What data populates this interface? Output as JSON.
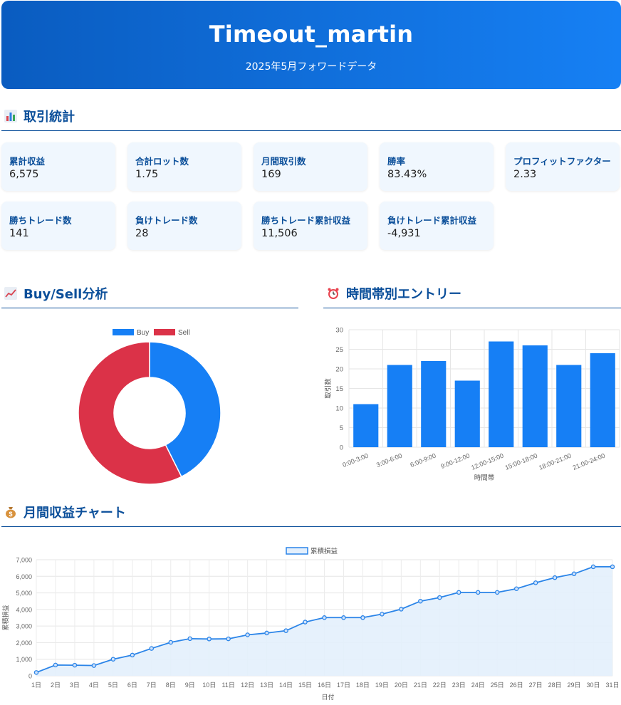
{
  "header": {
    "title": "Timeout_martin",
    "subtitle": "2025年5月フォワードデータ"
  },
  "sections": {
    "stats": {
      "icon": "bar-chart-icon",
      "title": "取引統計"
    },
    "buysell": {
      "icon": "trend-chart-icon",
      "title": "Buy/Sell分析"
    },
    "time": {
      "icon": "alarm-clock-icon",
      "title": "時間帯別エントリー"
    },
    "monthly": {
      "icon": "money-bag-icon",
      "title": "月間収益チャート"
    }
  },
  "stats": [
    {
      "label": "累計収益",
      "value": "6,575"
    },
    {
      "label": "合計ロット数",
      "value": "1.75"
    },
    {
      "label": "月間取引数",
      "value": "169"
    },
    {
      "label": "勝率",
      "value": "83.43%"
    },
    {
      "label": "プロフィットファクター",
      "value": "2.33"
    },
    {
      "label": "勝ちトレード数",
      "value": "141"
    },
    {
      "label": "負けトレード数",
      "value": "28"
    },
    {
      "label": "勝ちトレード累計収益",
      "value": "11,506"
    },
    {
      "label": "負けトレード累計収益",
      "value": "-4,931"
    }
  ],
  "chart_data": [
    {
      "type": "pie",
      "subtype": "doughnut",
      "categories": [
        "Buy",
        "Sell"
      ],
      "values": [
        72,
        97
      ],
      "colors": [
        "#167ff5",
        "#db3248"
      ],
      "legend": "top"
    },
    {
      "type": "bar",
      "categories": [
        "0:00-3:00",
        "3:00-6:00",
        "6:00-9:00",
        "9:00-12:00",
        "12:00-15:00",
        "15:00-18:00",
        "18:00-21:00",
        "21:00-24:00"
      ],
      "values": [
        11,
        21,
        22,
        17,
        27,
        26,
        21,
        24
      ],
      "xlabel": "時間帯",
      "ylabel": "取引数",
      "ylim": [
        0,
        30
      ],
      "yticks": [
        0,
        5,
        10,
        15,
        20,
        25,
        30
      ],
      "color": "#167ff5",
      "grid": true
    },
    {
      "type": "area",
      "x": [
        "1日",
        "2日",
        "3日",
        "4日",
        "5日",
        "6日",
        "7日",
        "8日",
        "9日",
        "10日",
        "11日",
        "12日",
        "13日",
        "14日",
        "15日",
        "16日",
        "17日",
        "18日",
        "19日",
        "20日",
        "21日",
        "22日",
        "23日",
        "24日",
        "25日",
        "26日",
        "27日",
        "28日",
        "29日",
        "30日",
        "31日"
      ],
      "series": [
        {
          "name": "累積損益",
          "values": [
            200,
            650,
            640,
            620,
            1000,
            1250,
            1650,
            2020,
            2240,
            2220,
            2230,
            2470,
            2580,
            2720,
            3240,
            3510,
            3510,
            3510,
            3720,
            4020,
            4500,
            4720,
            5030,
            5030,
            5030,
            5250,
            5610,
            5920,
            6150,
            6575,
            6575
          ]
        }
      ],
      "xlabel": "日付",
      "ylabel": "累積損益",
      "ylim": [
        0,
        7000
      ],
      "yticks": [
        "0",
        "1,000",
        "2,000",
        "3,000",
        "4,000",
        "5,000",
        "6,000",
        "7,000"
      ],
      "yticks_values": [
        0,
        1000,
        2000,
        3000,
        4000,
        5000,
        6000,
        7000
      ],
      "line_color": "#2a84e8",
      "fill_color": "#e3effc",
      "grid": true,
      "legend": "top"
    }
  ]
}
